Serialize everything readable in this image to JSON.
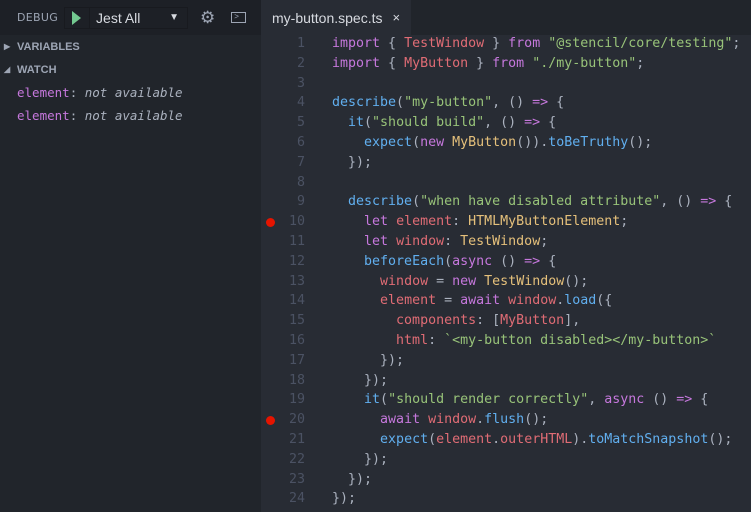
{
  "debug": {
    "label": "DEBUG",
    "config": "Jest All"
  },
  "sections": [
    {
      "label": "VARIABLES",
      "expanded": false
    },
    {
      "label": "WATCH",
      "expanded": true
    }
  ],
  "watch": [
    {
      "name": "element",
      "sep": ": ",
      "value": "not available"
    },
    {
      "name": "element",
      "sep": ": ",
      "value": "not available"
    }
  ],
  "tab": {
    "title": "my-button.spec.ts",
    "close": "×"
  },
  "breakpoints": [
    10,
    20
  ],
  "code": [
    [
      [
        "k",
        "import"
      ],
      [
        "p",
        " { "
      ],
      [
        "v",
        "TestWindow"
      ],
      [
        "p",
        " } "
      ],
      [
        "k",
        "from"
      ],
      [
        "p",
        " "
      ],
      [
        "s",
        "\"@stencil/core/testing\""
      ],
      [
        "p",
        ";"
      ]
    ],
    [
      [
        "k",
        "import"
      ],
      [
        "p",
        " { "
      ],
      [
        "v",
        "MyButton"
      ],
      [
        "p",
        " } "
      ],
      [
        "k",
        "from"
      ],
      [
        "p",
        " "
      ],
      [
        "s",
        "\"./my-button\""
      ],
      [
        "p",
        ";"
      ]
    ],
    [],
    [
      [
        "f",
        "describe"
      ],
      [
        "p",
        "("
      ],
      [
        "s",
        "\"my-button\""
      ],
      [
        "p",
        ", () "
      ],
      [
        "k",
        "=>"
      ],
      [
        "p",
        " {"
      ]
    ],
    [
      [
        "p",
        "  "
      ],
      [
        "f",
        "it"
      ],
      [
        "p",
        "("
      ],
      [
        "s",
        "\"should build\""
      ],
      [
        "p",
        ", () "
      ],
      [
        "k",
        "=>"
      ],
      [
        "p",
        " {"
      ]
    ],
    [
      [
        "p",
        "    "
      ],
      [
        "f",
        "expect"
      ],
      [
        "p",
        "("
      ],
      [
        "k",
        "new"
      ],
      [
        "p",
        " "
      ],
      [
        "c",
        "MyButton"
      ],
      [
        "p",
        "())."
      ],
      [
        "f",
        "toBeTruthy"
      ],
      [
        "p",
        "();"
      ]
    ],
    [
      [
        "p",
        "  });"
      ]
    ],
    [],
    [
      [
        "p",
        "  "
      ],
      [
        "f",
        "describe"
      ],
      [
        "p",
        "("
      ],
      [
        "s",
        "\"when have disabled attribute\""
      ],
      [
        "p",
        ", () "
      ],
      [
        "k",
        "=>"
      ],
      [
        "p",
        " {"
      ]
    ],
    [
      [
        "p",
        "    "
      ],
      [
        "k",
        "let"
      ],
      [
        "p",
        " "
      ],
      [
        "v",
        "element"
      ],
      [
        "p",
        ": "
      ],
      [
        "c",
        "HTMLMyButtonElement"
      ],
      [
        "p",
        ";"
      ]
    ],
    [
      [
        "p",
        "    "
      ],
      [
        "k",
        "let"
      ],
      [
        "p",
        " "
      ],
      [
        "v",
        "window"
      ],
      [
        "p",
        ": "
      ],
      [
        "c",
        "TestWindow"
      ],
      [
        "p",
        ";"
      ]
    ],
    [
      [
        "p",
        "    "
      ],
      [
        "f",
        "beforeEach"
      ],
      [
        "p",
        "("
      ],
      [
        "k",
        "async"
      ],
      [
        "p",
        " () "
      ],
      [
        "k",
        "=>"
      ],
      [
        "p",
        " {"
      ]
    ],
    [
      [
        "p",
        "      "
      ],
      [
        "v",
        "window"
      ],
      [
        "p",
        " = "
      ],
      [
        "k",
        "new"
      ],
      [
        "p",
        " "
      ],
      [
        "c",
        "TestWindow"
      ],
      [
        "p",
        "();"
      ]
    ],
    [
      [
        "p",
        "      "
      ],
      [
        "v",
        "element"
      ],
      [
        "p",
        " = "
      ],
      [
        "k",
        "await"
      ],
      [
        "p",
        " "
      ],
      [
        "v",
        "window"
      ],
      [
        "p",
        "."
      ],
      [
        "f",
        "load"
      ],
      [
        "p",
        "({"
      ]
    ],
    [
      [
        "p",
        "        "
      ],
      [
        "v",
        "components"
      ],
      [
        "p",
        ": ["
      ],
      [
        "v",
        "MyButton"
      ],
      [
        "p",
        "],"
      ]
    ],
    [
      [
        "p",
        "        "
      ],
      [
        "v",
        "html"
      ],
      [
        "p",
        ": "
      ],
      [
        "s",
        "`<my-button disabled></my-button>`"
      ]
    ],
    [
      [
        "p",
        "      });"
      ]
    ],
    [
      [
        "p",
        "    });"
      ]
    ],
    [
      [
        "p",
        "    "
      ],
      [
        "f",
        "it"
      ],
      [
        "p",
        "("
      ],
      [
        "s",
        "\"should render correctly\""
      ],
      [
        "p",
        ", "
      ],
      [
        "k",
        "async"
      ],
      [
        "p",
        " () "
      ],
      [
        "k",
        "=>"
      ],
      [
        "p",
        " {"
      ]
    ],
    [
      [
        "p",
        "      "
      ],
      [
        "k",
        "await"
      ],
      [
        "p",
        " "
      ],
      [
        "v",
        "window"
      ],
      [
        "p",
        "."
      ],
      [
        "f",
        "flush"
      ],
      [
        "p",
        "();"
      ]
    ],
    [
      [
        "p",
        "      "
      ],
      [
        "f",
        "expect"
      ],
      [
        "p",
        "("
      ],
      [
        "v",
        "element"
      ],
      [
        "p",
        "."
      ],
      [
        "v",
        "outerHTML"
      ],
      [
        "p",
        ")."
      ],
      [
        "f",
        "toMatchSnapshot"
      ],
      [
        "p",
        "();"
      ]
    ],
    [
      [
        "p",
        "    });"
      ]
    ],
    [
      [
        "p",
        "  });"
      ]
    ],
    [
      [
        "p",
        "});"
      ]
    ]
  ]
}
